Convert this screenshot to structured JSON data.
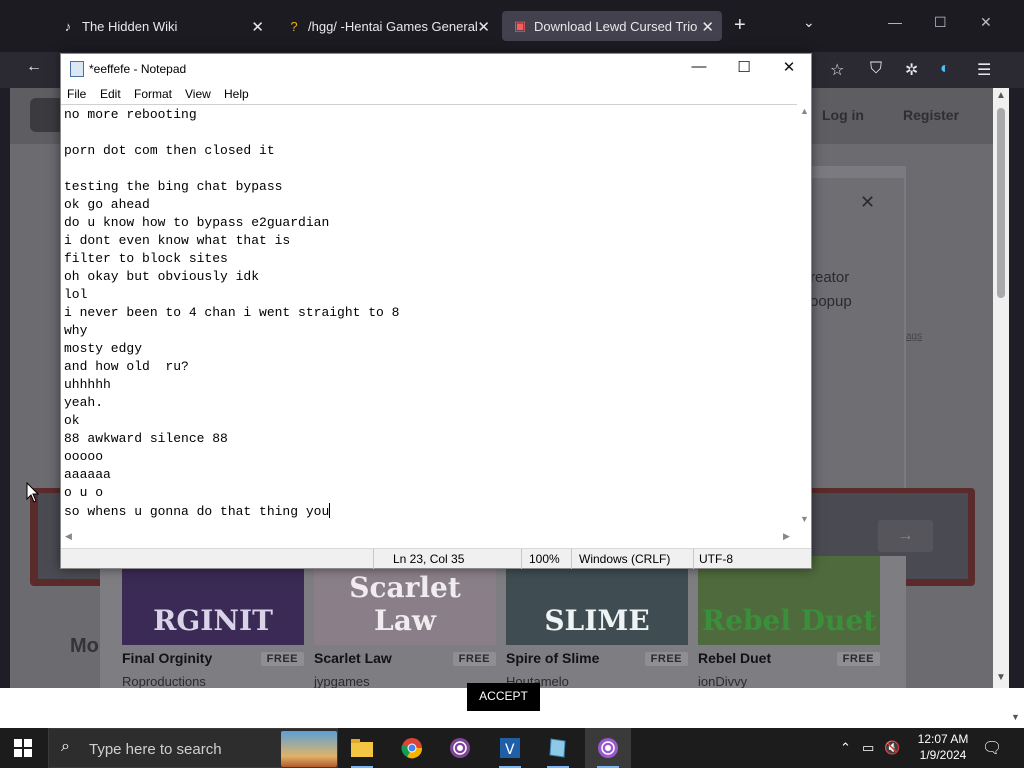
{
  "browser": {
    "tabs": [
      {
        "label": "The Hidden Wiki",
        "icon": "wiki-favicon"
      },
      {
        "label": "/hgg/ -Hentai Games General",
        "icon": "question-favicon"
      },
      {
        "label": "Download Lewd Cursed Trio by",
        "icon": "itchio-favicon"
      }
    ],
    "active_tab": 2
  },
  "page": {
    "login": "Log in",
    "register": "Register",
    "modal_text_line1": "reator",
    "modal_text_line2": "oopup",
    "modal_link": "ags",
    "mo_label": "Mo",
    "accept": "ACCEPT",
    "games": [
      {
        "name": "Final Orginity",
        "author": "Roproductions",
        "free": "FREE",
        "cover_title": "RGINIT",
        "cover_bg": "#3a2a55",
        "cover_fg": "#d9d3e8"
      },
      {
        "name": "Scarlet Law",
        "author": "jypgames",
        "free": "FREE",
        "cover_title": "Scarlet Law",
        "cover_bg": "#8a7f88",
        "cover_fg": "#f0ecf0"
      },
      {
        "name": "Spire of Slime",
        "author": "Houtamelo",
        "free": "FREE",
        "cover_title": "SLIME",
        "cover_bg": "#3f4d52",
        "cover_fg": "#eef3f3"
      },
      {
        "name": "Rebel Duet",
        "author": "ionDivvy",
        "free": "FREE",
        "cover_title": "Rebel Duet",
        "cover_bg": "#4f6a3c",
        "cover_fg": "#3b8f3b"
      }
    ]
  },
  "notepad": {
    "title": "*eeffefe - Notepad",
    "menu": [
      "File",
      "Edit",
      "Format",
      "View",
      "Help"
    ],
    "lines": [
      "no more rebooting",
      "",
      "porn dot com then closed it",
      "",
      "testing the bing chat bypass",
      "ok go ahead",
      "do u know how to bypass e2guardian",
      "i dont even know what that is",
      "filter to block sites",
      "oh okay but obviously idk",
      "lol",
      "i never been to 4 chan i went straight to 8",
      "why",
      "mosty edgy",
      "and how old  ru?",
      "uhhhhh",
      "yeah.",
      "ok",
      "88 awkward silence 88",
      "ooooo",
      "aaaaaa",
      "o u o",
      "so whens u gonna do that thing you"
    ],
    "status": {
      "position": "Ln 23, Col 35",
      "zoom": "100%",
      "line_ending": "Windows (CRLF)",
      "encoding": "UTF-8"
    }
  },
  "taskbar": {
    "search_placeholder": "Type here to search",
    "time": "12:07 AM",
    "date": "1/9/2024",
    "apps": [
      "file-explorer",
      "chrome",
      "tor-browser",
      "visual-studio",
      "notepad",
      "tor-browser-active"
    ]
  }
}
